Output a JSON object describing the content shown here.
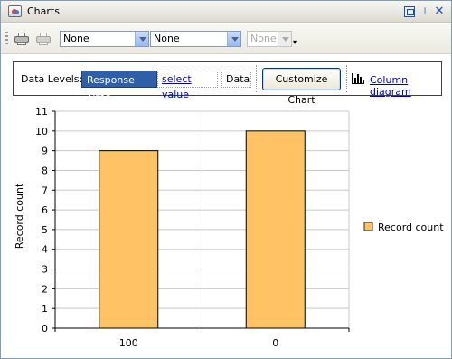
{
  "window": {
    "title": "Charts"
  },
  "icons": {
    "title": "chart-window-icon",
    "restore": "restore-icon",
    "pin": "pin-icon",
    "close": "close-icon",
    "print": "print-icon",
    "print_preview": "print-preview-icon",
    "overflow": "chevron-down-icon",
    "column": "column-chart-icon"
  },
  "toolbar": {
    "select1": "None",
    "select2": "None",
    "select3": "None",
    "more": "▾"
  },
  "levels": {
    "label": "Data Levels:",
    "selected_level": "Response Time",
    "select_value": "select value",
    "data": "Data",
    "customize_label": "Customize Chart",
    "column_diagram_label": "Column diagram"
  },
  "chart_data": {
    "type": "bar",
    "categories": [
      "100",
      "0"
    ],
    "series": [
      {
        "name": "Record count",
        "values": [
          9,
          10
        ],
        "color": "#ffc264"
      }
    ],
    "ylabel": "Record count",
    "xlabel": "",
    "ylim": [
      0,
      11
    ],
    "yticks": [
      "0",
      "1",
      "2",
      "3",
      "4",
      "5",
      "6",
      "7",
      "8",
      "9",
      "10",
      "11"
    ],
    "grid": true,
    "legend": "right"
  }
}
